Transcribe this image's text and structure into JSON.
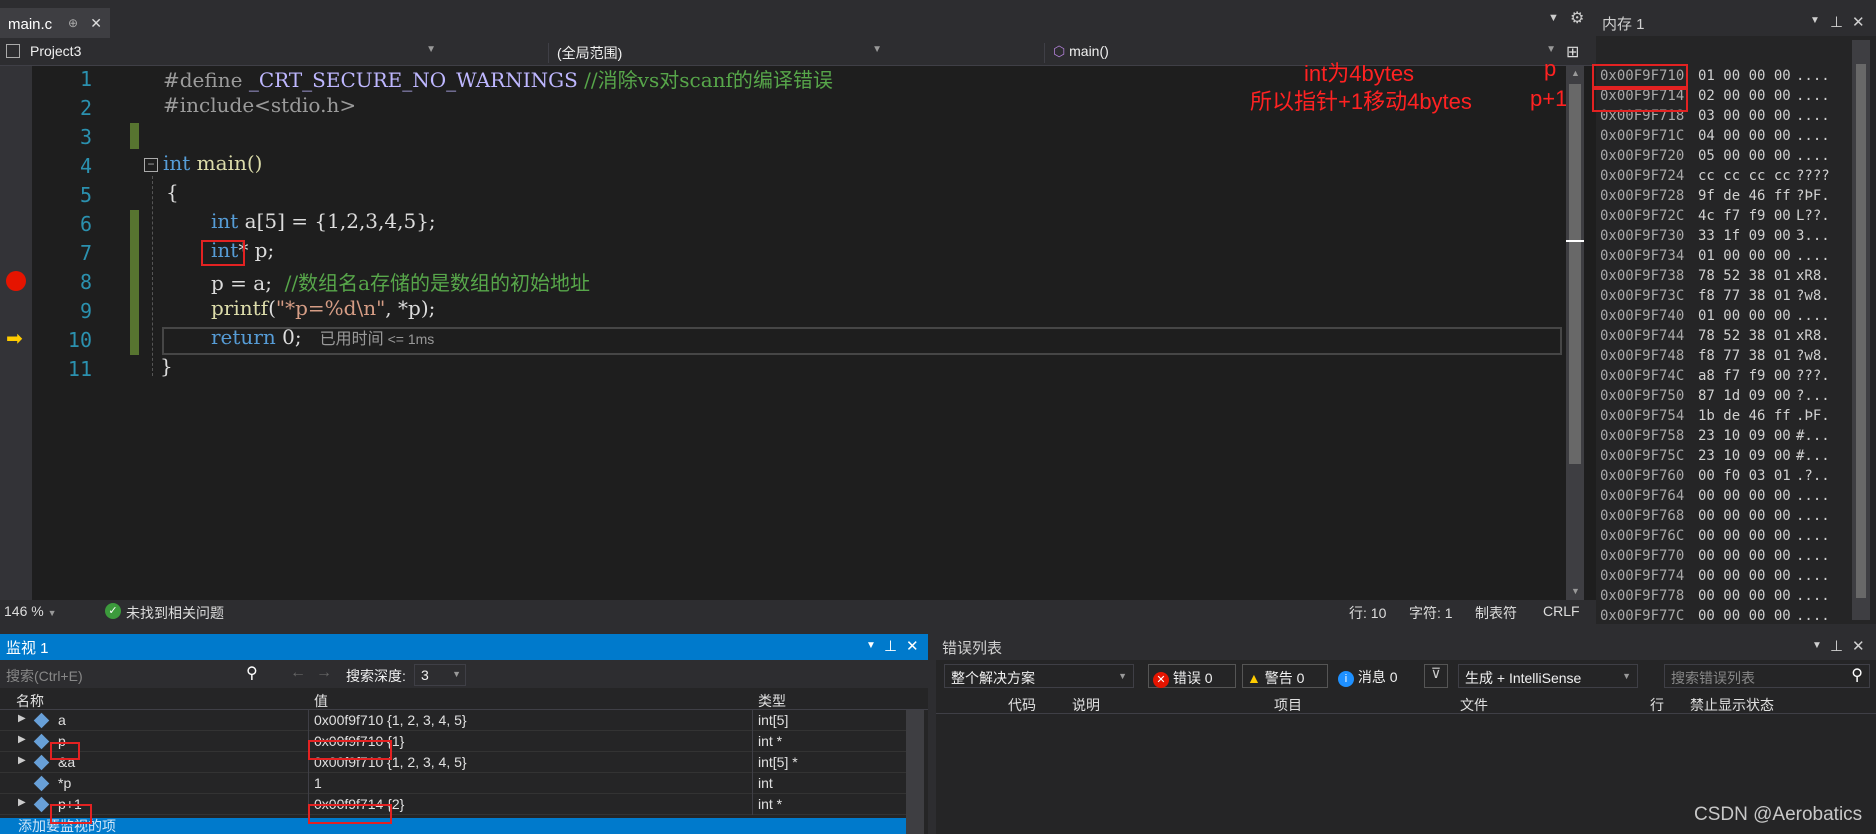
{
  "tab": {
    "title": "main.c"
  },
  "nav": {
    "project": "Project3",
    "scope": "(全局范围)",
    "function": "main()"
  },
  "code": {
    "line_numbers": [
      "1",
      "2",
      "3",
      "4",
      "5",
      "6",
      "7",
      "8",
      "9",
      "10",
      "11"
    ],
    "l1_directive": "#define ",
    "l1_macro": "_CRT_SECURE_NO_WARNINGS",
    "l1_comment": " //消除vs对scanf的编译错误",
    "l2": "#include<stdio.h>",
    "l4_kw": "int",
    "l4_rest": " main()",
    "l5": "{",
    "l6_kw": "int",
    "l6_rest": " a[5] = {1,2,3,4,5};",
    "l7_kw": "int",
    "l7_rest": "* p;",
    "l8_code": "p = a;  ",
    "l8_comment": "//数组名a存储的是数组的初始地址",
    "l9_fn": "printf",
    "l9_open": "(",
    "l9_str": "\"*p=%d\\n\"",
    "l9_rest": ", *p);",
    "l10_kw": "return",
    "l10_rest": " 0;",
    "l10_elapsed": "已用时间",
    "l10_ms": "<= 1ms",
    "l11": "}"
  },
  "annotations": {
    "int_size": "int为4bytes",
    "pointer_move": "所以指针+1移动4bytes",
    "p_label": "p",
    "p1_label": "p+1"
  },
  "memory": {
    "title": "内存 1",
    "rows": [
      {
        "addr": "0x00F9F710",
        "bytes": "01 00 00 00",
        "ascii": "...."
      },
      {
        "addr": "0x00F9F714",
        "bytes": "02 00 00 00",
        "ascii": "...."
      },
      {
        "addr": "0x00F9F718",
        "bytes": "03 00 00 00",
        "ascii": "...."
      },
      {
        "addr": "0x00F9F71C",
        "bytes": "04 00 00 00",
        "ascii": "...."
      },
      {
        "addr": "0x00F9F720",
        "bytes": "05 00 00 00",
        "ascii": "...."
      },
      {
        "addr": "0x00F9F724",
        "bytes": "cc cc cc cc",
        "ascii": "????"
      },
      {
        "addr": "0x00F9F728",
        "bytes": "9f de 46 ff",
        "ascii": "?ÞF."
      },
      {
        "addr": "0x00F9F72C",
        "bytes": "4c f7 f9 00",
        "ascii": "L??."
      },
      {
        "addr": "0x00F9F730",
        "bytes": "33 1f 09 00",
        "ascii": "3..."
      },
      {
        "addr": "0x00F9F734",
        "bytes": "01 00 00 00",
        "ascii": "...."
      },
      {
        "addr": "0x00F9F738",
        "bytes": "78 52 38 01",
        "ascii": "xR8."
      },
      {
        "addr": "0x00F9F73C",
        "bytes": "f8 77 38 01",
        "ascii": "?w8."
      },
      {
        "addr": "0x00F9F740",
        "bytes": "01 00 00 00",
        "ascii": "...."
      },
      {
        "addr": "0x00F9F744",
        "bytes": "78 52 38 01",
        "ascii": "xR8."
      },
      {
        "addr": "0x00F9F748",
        "bytes": "f8 77 38 01",
        "ascii": "?w8."
      },
      {
        "addr": "0x00F9F74C",
        "bytes": "a8 f7 f9 00",
        "ascii": "???."
      },
      {
        "addr": "0x00F9F750",
        "bytes": "87 1d 09 00",
        "ascii": "?..."
      },
      {
        "addr": "0x00F9F754",
        "bytes": "1b de 46 ff",
        "ascii": ".ÞF."
      },
      {
        "addr": "0x00F9F758",
        "bytes": "23 10 09 00",
        "ascii": "#..."
      },
      {
        "addr": "0x00F9F75C",
        "bytes": "23 10 09 00",
        "ascii": "#..."
      },
      {
        "addr": "0x00F9F760",
        "bytes": "00 f0 03 01",
        "ascii": ".?.."
      },
      {
        "addr": "0x00F9F764",
        "bytes": "00 00 00 00",
        "ascii": "...."
      },
      {
        "addr": "0x00F9F768",
        "bytes": "00 00 00 00",
        "ascii": "...."
      },
      {
        "addr": "0x00F9F76C",
        "bytes": "00 00 00 00",
        "ascii": "...."
      },
      {
        "addr": "0x00F9F770",
        "bytes": "00 00 00 00",
        "ascii": "...."
      },
      {
        "addr": "0x00F9F774",
        "bytes": "00 00 00 00",
        "ascii": "...."
      },
      {
        "addr": "0x00F9F778",
        "bytes": "00 00 00 00",
        "ascii": "...."
      },
      {
        "addr": "0x00F9F77C",
        "bytes": "00 00 00 00",
        "ascii": "...."
      }
    ]
  },
  "status": {
    "zoom": "146 %",
    "issues": "未找到相关问题",
    "line": "行: 10",
    "char": "字符: 1",
    "tabs": "制表符",
    "eol": "CRLF"
  },
  "watch": {
    "title": "监视 1",
    "search_placeholder": "搜索(Ctrl+E)",
    "depth_label": "搜索深度:",
    "depth_value": "3",
    "col_name": "名称",
    "col_value": "值",
    "col_type": "类型",
    "rows": [
      {
        "name": "a",
        "value_hl": "",
        "value": "0x00f9f710 {1, 2, 3, 4, 5}",
        "type": "int[5]"
      },
      {
        "name": "p",
        "value_hl": "0x00f9f710",
        "value": " {1}",
        "type": "int *"
      },
      {
        "name": "&a",
        "value_hl": "",
        "value": "0x00f9f710 {1, 2, 3, 4, 5}",
        "type": "int[5] *"
      },
      {
        "name": "*p",
        "value_hl": "",
        "value": "1",
        "type": "int"
      },
      {
        "name": "p+1",
        "value_hl": "0x00f9f714",
        "value": " {2}",
        "type": "int *"
      }
    ],
    "add_item": "添加要监视的项"
  },
  "errors": {
    "title": "错误列表",
    "scope": "整个解决方案",
    "errors_btn": "错误 0",
    "warnings_btn": "警告 0",
    "messages_btn": "消息 0",
    "build": "生成 + IntelliSense",
    "search_placeholder": "搜索错误列表",
    "col_code": "代码",
    "col_desc": "说明",
    "col_project": "项目",
    "col_file": "文件",
    "col_line": "行",
    "col_suppress": "禁止显示状态"
  },
  "watermark": "CSDN @Aerobatics",
  "colors": {
    "accent": "#007acc",
    "annotation": "#ff2222",
    "breakpoint": "#e51400",
    "changebar": "#577430"
  }
}
